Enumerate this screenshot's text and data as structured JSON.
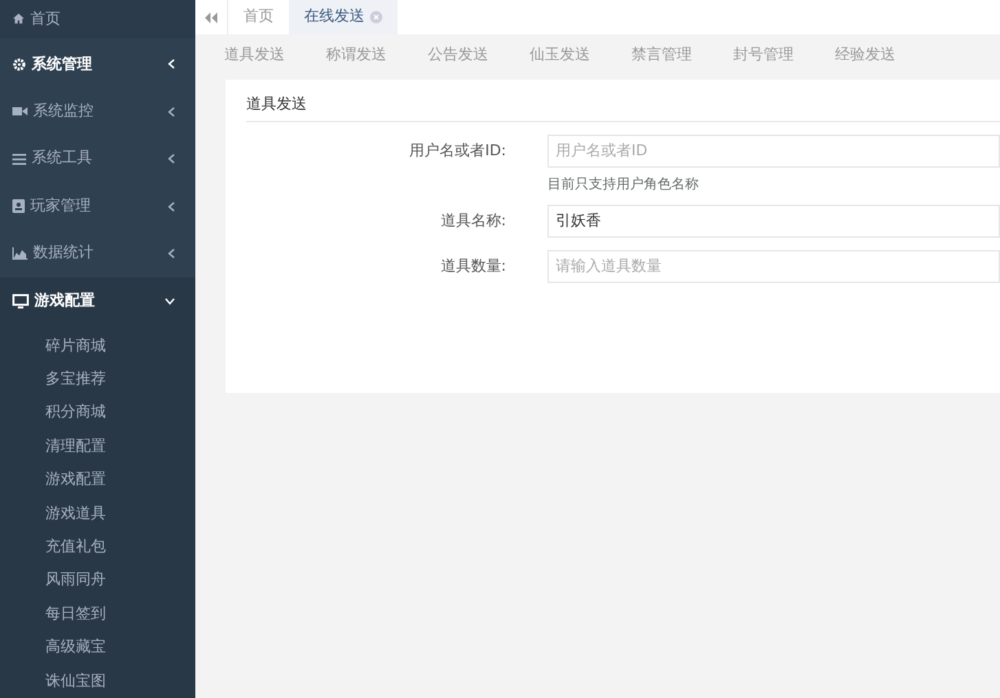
{
  "sidebar": {
    "items": [
      {
        "label": "首页",
        "bold": false
      },
      {
        "label": "系统管理",
        "bold": true,
        "expanded": false
      },
      {
        "label": "系统监控",
        "bold": false,
        "expanded": false
      },
      {
        "label": "系统工具",
        "bold": false,
        "expanded": false
      },
      {
        "label": "玩家管理",
        "bold": false,
        "expanded": false
      },
      {
        "label": "数据统计",
        "bold": false,
        "expanded": false
      },
      {
        "label": "游戏配置",
        "bold": true,
        "expanded": true,
        "children": [
          {
            "label": "碎片商城"
          },
          {
            "label": "多宝推荐"
          },
          {
            "label": "积分商城"
          },
          {
            "label": "清理配置"
          },
          {
            "label": "游戏配置"
          },
          {
            "label": "游戏道具"
          },
          {
            "label": "充值礼包"
          },
          {
            "label": "风雨同舟"
          },
          {
            "label": "每日签到"
          },
          {
            "label": "高级藏宝"
          },
          {
            "label": "诛仙宝图"
          }
        ]
      }
    ]
  },
  "tabs": [
    {
      "label": "首页",
      "selected": false,
      "closable": false
    },
    {
      "label": "在线发送",
      "selected": true,
      "closable": true
    }
  ],
  "subnav": [
    "道具发送",
    "称谓发送",
    "公告发送",
    "仙玉发送",
    "禁言管理",
    "封号管理",
    "经验发送"
  ],
  "panel": {
    "title": "道具发送",
    "fields": [
      {
        "label": "用户名或者ID:",
        "placeholder": "用户名或者ID",
        "help": "目前只支持用户角色名称"
      },
      {
        "label": "道具名称:",
        "value": "引妖香"
      },
      {
        "label": "道具数量:",
        "placeholder": "请输入道具数量"
      }
    ]
  }
}
